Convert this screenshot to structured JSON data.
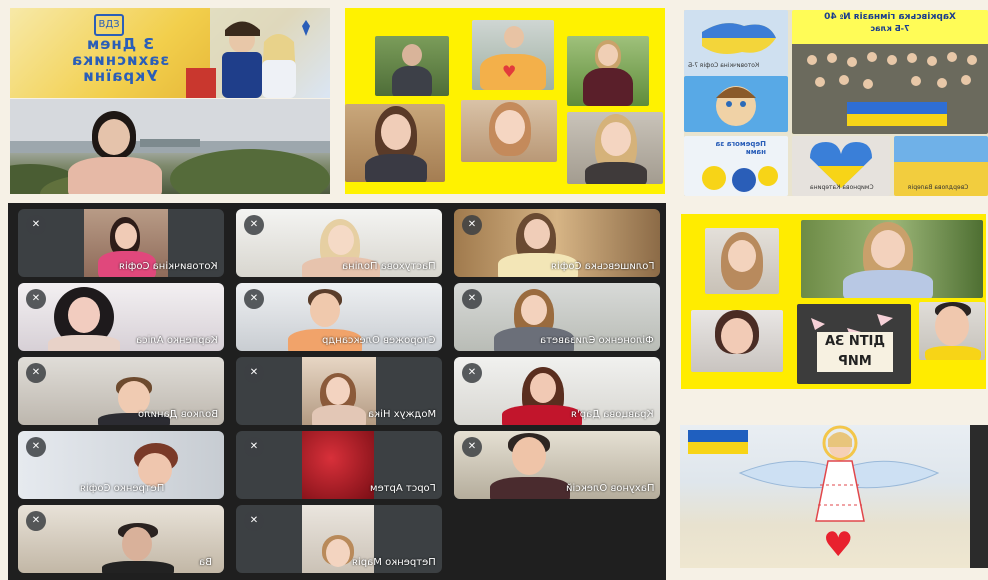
{
  "poster": {
    "title": "З Днем захисника України",
    "emblem": "ВДЗ"
  },
  "collage": {
    "school_title": "Харківська гімназія № 40",
    "school_subtitle": "7-Б клас",
    "caption_1": "Котовичкіна Софія 7-Б",
    "caption_2": "Перемога за нами",
    "caption_3": "Смирнова Катерина",
    "caption_4": "Свердлова Валерія"
  },
  "poster_collage": {
    "sign_text": "ДІТИ ЗА МИР"
  },
  "meeting": {
    "mic_icon": "mic-off-icon",
    "participants": [
      {
        "name": "Котовичкіна Софія"
      },
      {
        "name": "Пастухова Поліна"
      },
      {
        "name": "Голишевська Софія"
      },
      {
        "name": "Карпенко Аліса"
      },
      {
        "name": "Сторожев Олександр"
      },
      {
        "name": "Філоненко Єлизавета"
      },
      {
        "name": "Волков Данило"
      },
      {
        "name": "Моджух Ніка"
      },
      {
        "name": "Кравцова Дар'я"
      },
      {
        "name": "Петренко Софія"
      },
      {
        "name": "Горст Артем"
      },
      {
        "name": "Пахунов Олексій"
      },
      {
        "name": "Ва"
      },
      {
        "name": "Петренко Марія"
      }
    ]
  },
  "colors": {
    "yellow": "#fff200",
    "ukraine_blue": "#1f5fbf",
    "ukraine_yellow": "#f7d417",
    "tile_bg": "#3c4043",
    "grid_bg": "#1f1f1f"
  }
}
